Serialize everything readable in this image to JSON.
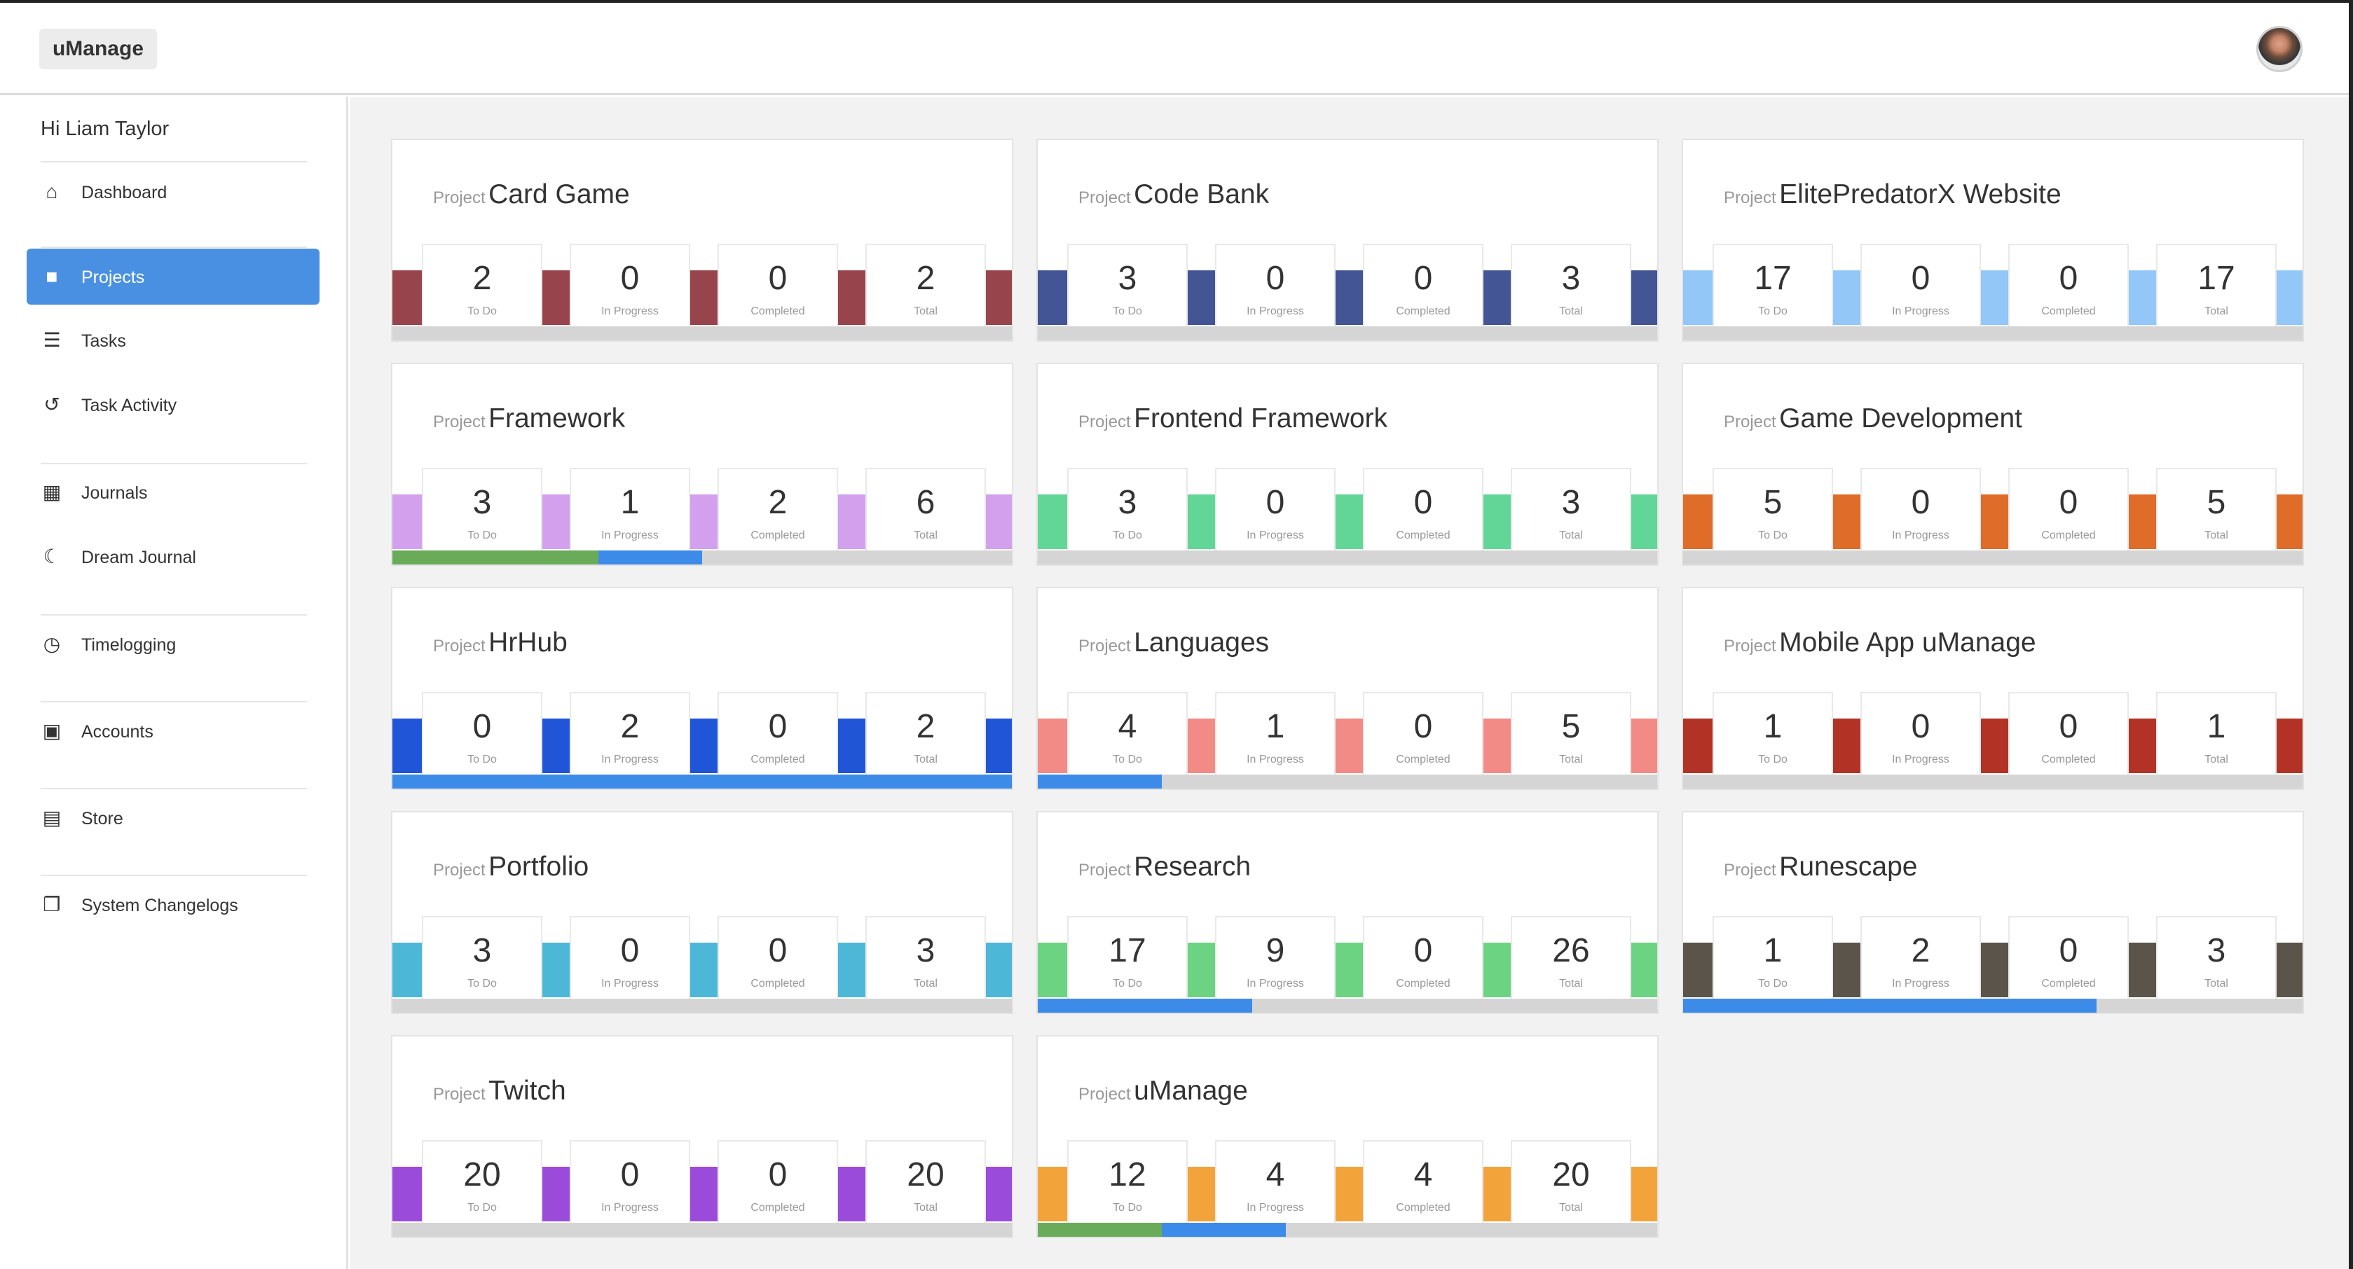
{
  "app": {
    "brand": "uManage"
  },
  "user": {
    "greeting": "Hi Liam Taylor"
  },
  "sidebar": {
    "items": [
      {
        "label": "Dashboard",
        "icon": "home-icon",
        "active": false
      },
      {
        "label": "Projects",
        "icon": "projects-icon",
        "active": true
      },
      {
        "label": "Tasks",
        "icon": "tasks-icon",
        "active": false
      },
      {
        "label": "Task Activity",
        "icon": "history-icon",
        "active": false
      },
      {
        "label": "Journals",
        "icon": "calendar-icon",
        "active": false
      },
      {
        "label": "Dream Journal",
        "icon": "moon-icon",
        "active": false
      },
      {
        "label": "Timelogging",
        "icon": "clock-icon",
        "active": false
      },
      {
        "label": "Accounts",
        "icon": "lock-icon",
        "active": false
      },
      {
        "label": "Store",
        "icon": "basket-icon",
        "active": false
      },
      {
        "label": "System Changelogs",
        "icon": "copy-icon",
        "active": false
      }
    ]
  },
  "labels": {
    "project_prefix": "Project",
    "todo": "To Do",
    "in_progress": "In Progress",
    "completed": "Completed",
    "total": "Total"
  },
  "colors": {
    "accent": "#4a90e2",
    "progress_green": "#6aab5a",
    "progress_blue": "#3d8be8",
    "track": "#d5d5d5"
  },
  "projects": [
    {
      "name": "Card Game",
      "color": "#98444c",
      "todo": 2,
      "in_progress": 0,
      "completed": 0,
      "total": 2,
      "progress": {
        "completed_fraction": 0,
        "in_progress_fraction": 0
      }
    },
    {
      "name": "Code Bank",
      "color": "#435594",
      "todo": 3,
      "in_progress": 0,
      "completed": 0,
      "total": 3,
      "progress": {
        "completed_fraction": 0,
        "in_progress_fraction": 0
      }
    },
    {
      "name": "ElitePredatorX Website",
      "color": "#92c7f7",
      "todo": 17,
      "in_progress": 0,
      "completed": 0,
      "total": 17,
      "progress": {
        "completed_fraction": 0,
        "in_progress_fraction": 0
      }
    },
    {
      "name": "Framework",
      "color": "#d3a0ee",
      "todo": 3,
      "in_progress": 1,
      "completed": 2,
      "total": 6,
      "progress": {
        "completed_fraction": 0.333,
        "in_progress_fraction": 0.167
      }
    },
    {
      "name": "Frontend Framework",
      "color": "#62d696",
      "todo": 3,
      "in_progress": 0,
      "completed": 0,
      "total": 3,
      "progress": {
        "completed_fraction": 0,
        "in_progress_fraction": 0
      }
    },
    {
      "name": "Game Development",
      "color": "#e06c2a",
      "todo": 5,
      "in_progress": 0,
      "completed": 0,
      "total": 5,
      "progress": {
        "completed_fraction": 0,
        "in_progress_fraction": 0
      }
    },
    {
      "name": "HrHub",
      "color": "#2055d8",
      "todo": 0,
      "in_progress": 2,
      "completed": 0,
      "total": 2,
      "progress": {
        "completed_fraction": 0,
        "in_progress_fraction": 1
      }
    },
    {
      "name": "Languages",
      "color": "#f28b85",
      "todo": 4,
      "in_progress": 1,
      "completed": 0,
      "total": 5,
      "progress": {
        "completed_fraction": 0,
        "in_progress_fraction": 0.2
      }
    },
    {
      "name": "Mobile App uManage",
      "color": "#b23325",
      "todo": 1,
      "in_progress": 0,
      "completed": 0,
      "total": 1,
      "progress": {
        "completed_fraction": 0,
        "in_progress_fraction": 0
      }
    },
    {
      "name": "Portfolio",
      "color": "#4db7d8",
      "todo": 3,
      "in_progress": 0,
      "completed": 0,
      "total": 3,
      "progress": {
        "completed_fraction": 0,
        "in_progress_fraction": 0
      }
    },
    {
      "name": "Research",
      "color": "#6cd382",
      "todo": 17,
      "in_progress": 9,
      "completed": 0,
      "total": 26,
      "progress": {
        "completed_fraction": 0,
        "in_progress_fraction": 0.346
      }
    },
    {
      "name": "Runescape",
      "color": "#5b544a",
      "todo": 1,
      "in_progress": 2,
      "completed": 0,
      "total": 3,
      "progress": {
        "completed_fraction": 0,
        "in_progress_fraction": 0.667
      }
    },
    {
      "name": "Twitch",
      "color": "#9a4bda",
      "todo": 20,
      "in_progress": 0,
      "completed": 0,
      "total": 20,
      "progress": {
        "completed_fraction": 0,
        "in_progress_fraction": 0
      }
    },
    {
      "name": "uManage",
      "color": "#f2a43a",
      "todo": 12,
      "in_progress": 4,
      "completed": 4,
      "total": 20,
      "progress": {
        "completed_fraction": 0.2,
        "in_progress_fraction": 0.2
      }
    }
  ]
}
